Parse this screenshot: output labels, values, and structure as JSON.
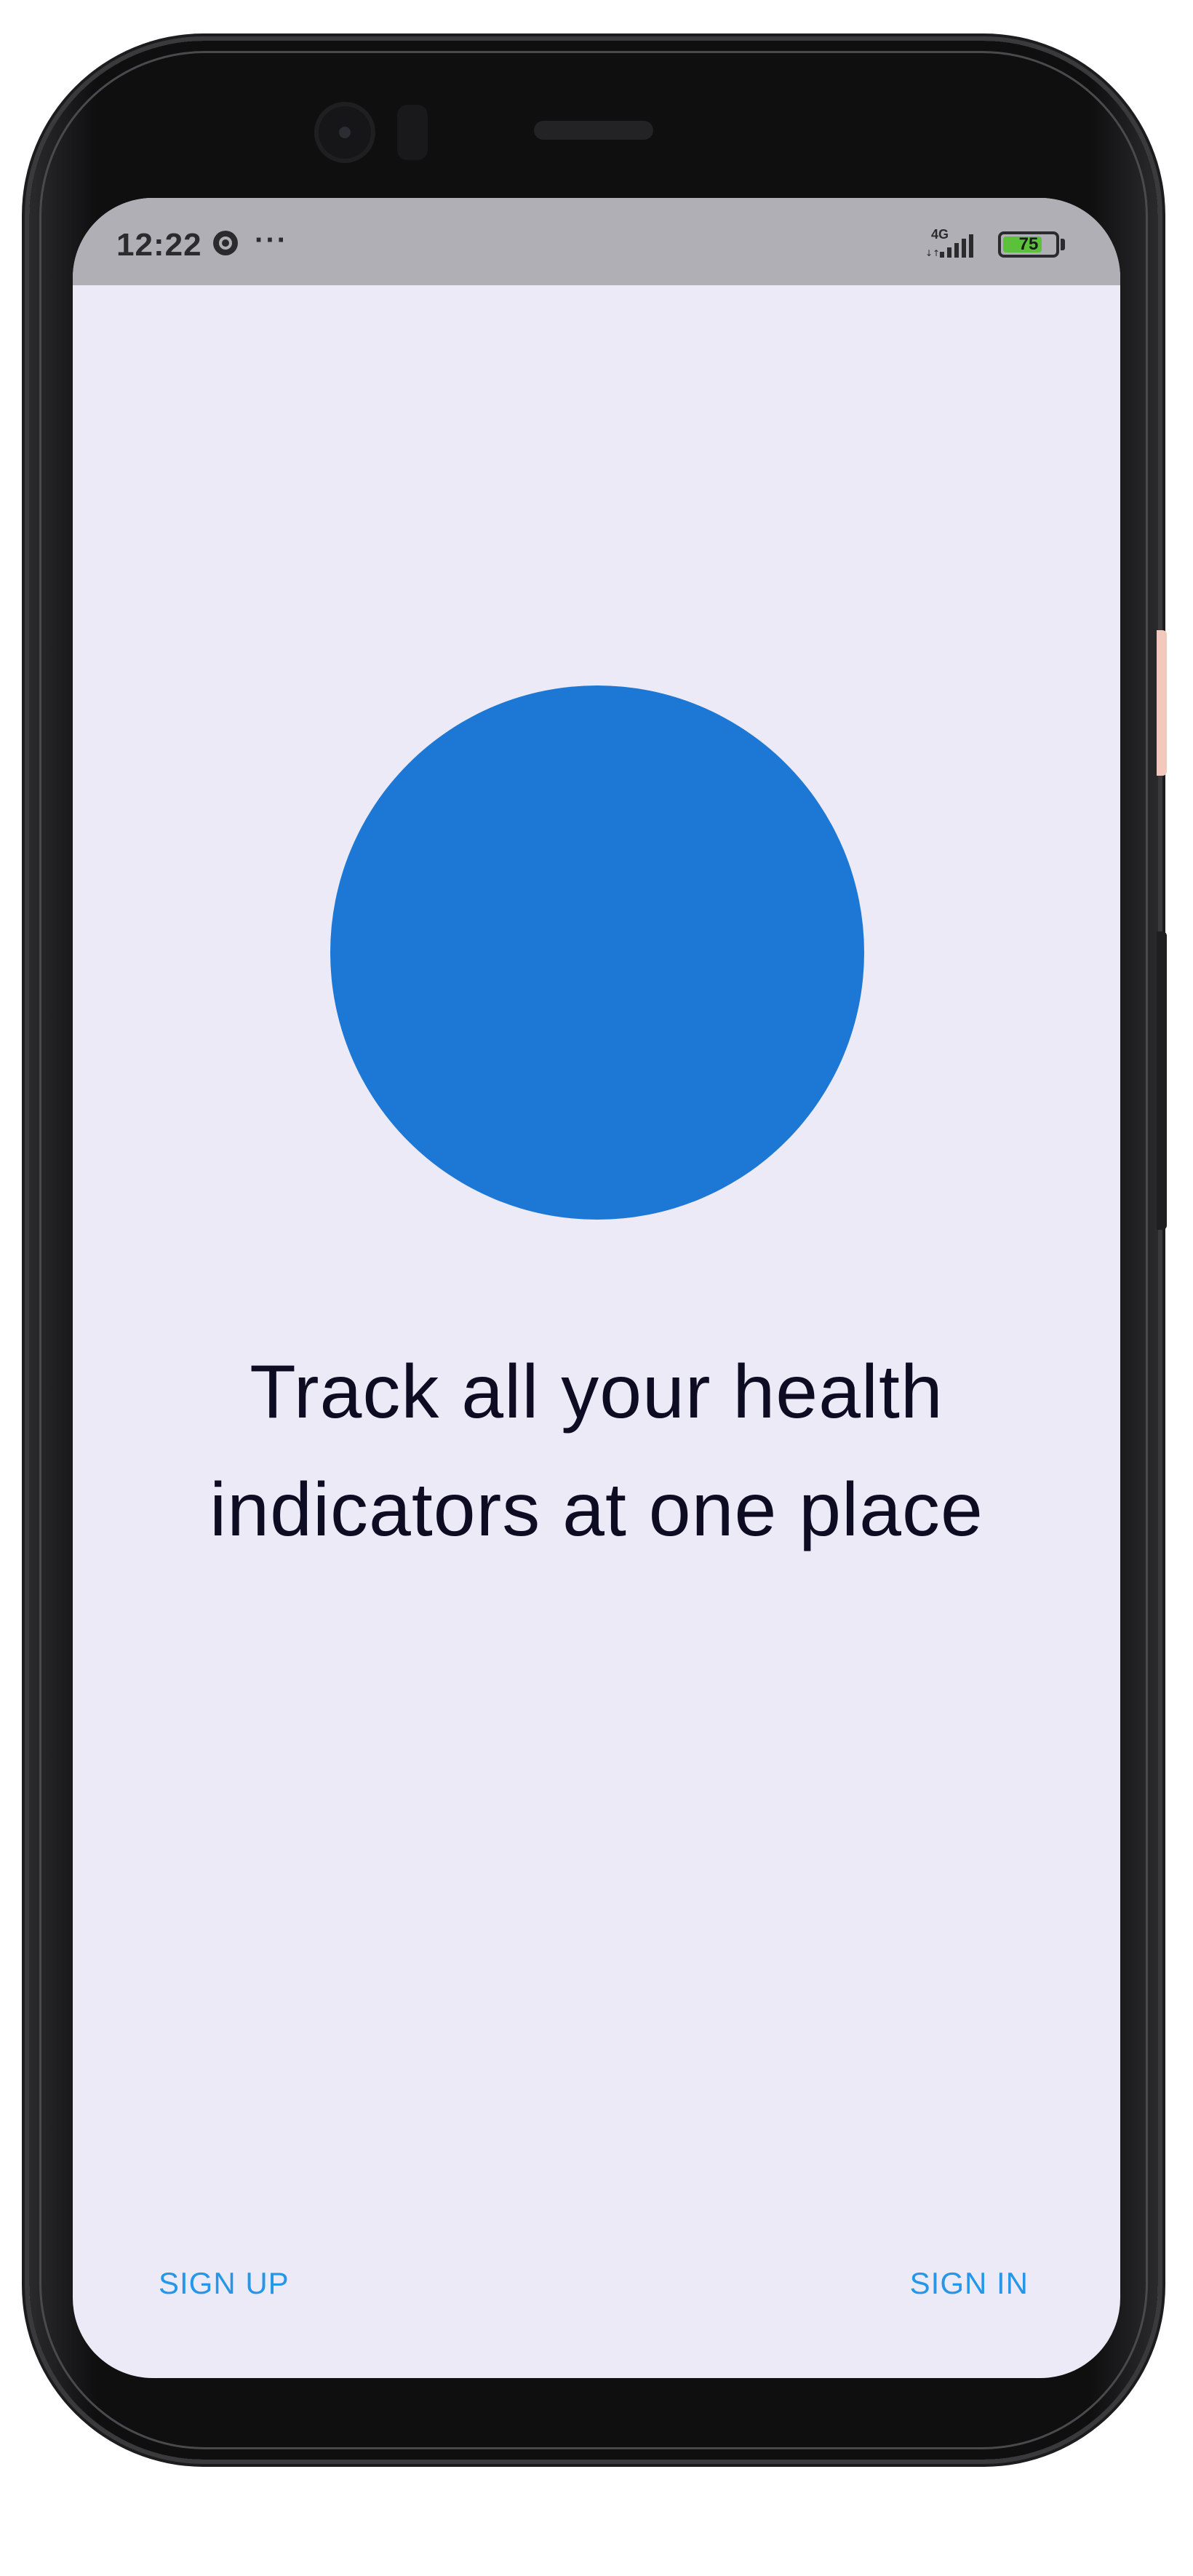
{
  "status_bar": {
    "time": "12:22",
    "media_icon": "play-circle-icon",
    "more_indicator": "···",
    "network_label": "4G",
    "signal_icon": "signal-bars-icon",
    "battery_level": "75",
    "battery_fraction": 0.75,
    "battery_color": "#5cc13a",
    "background_color": "#b0afb5"
  },
  "hero": {
    "shape": "circle",
    "color": "#1c78d4"
  },
  "headline": {
    "line1": "Track all your health",
    "line2": "indicators at one place"
  },
  "actions": {
    "sign_up_label": "SIGN UP",
    "sign_in_label": "SIGN IN",
    "link_color": "#2596e8"
  },
  "theme": {
    "screen_background": "#eceaf7",
    "text_color": "#0d0c22"
  }
}
